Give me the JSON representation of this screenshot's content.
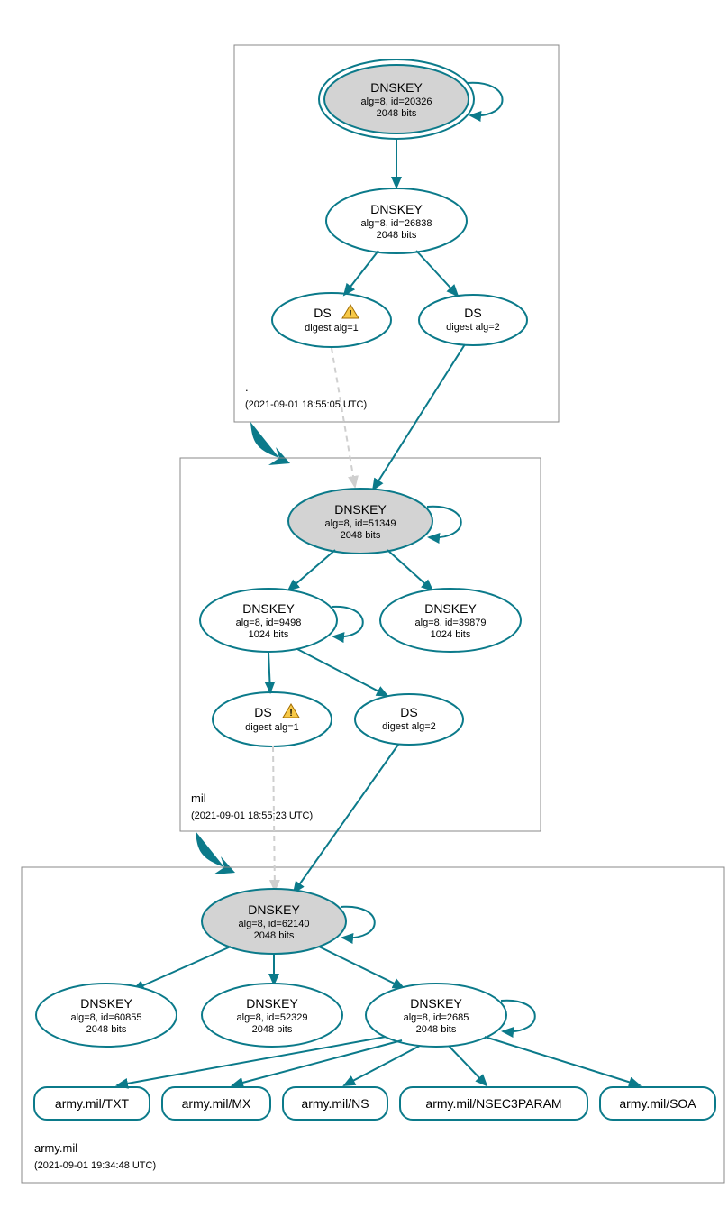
{
  "colors": {
    "stroke": "#0b7a8a",
    "fill_key": "#d3d3d3"
  },
  "zones": {
    "root": {
      "label": ".",
      "timestamp": "(2021-09-01 18:55:05 UTC)"
    },
    "mil": {
      "label": "mil",
      "timestamp": "(2021-09-01 18:55:23 UTC)"
    },
    "army": {
      "label": "army.mil",
      "timestamp": "(2021-09-01 19:34:48 UTC)"
    }
  },
  "nodes": {
    "root_ksk": {
      "title": "DNSKEY",
      "line1": "alg=8, id=20326",
      "line2": "2048 bits"
    },
    "root_zsk": {
      "title": "DNSKEY",
      "line1": "alg=8, id=26838",
      "line2": "2048 bits"
    },
    "root_ds1": {
      "title": "DS",
      "line1": "digest alg=1",
      "warn": true
    },
    "root_ds2": {
      "title": "DS",
      "line1": "digest alg=2"
    },
    "mil_ksk": {
      "title": "DNSKEY",
      "line1": "alg=8, id=51349",
      "line2": "2048 bits"
    },
    "mil_zsk1": {
      "title": "DNSKEY",
      "line1": "alg=8, id=9498",
      "line2": "1024 bits"
    },
    "mil_zsk2": {
      "title": "DNSKEY",
      "line1": "alg=8, id=39879",
      "line2": "1024 bits"
    },
    "mil_ds1": {
      "title": "DS",
      "line1": "digest alg=1",
      "warn": true
    },
    "mil_ds2": {
      "title": "DS",
      "line1": "digest alg=2"
    },
    "army_ksk": {
      "title": "DNSKEY",
      "line1": "alg=8, id=62140",
      "line2": "2048 bits"
    },
    "army_k1": {
      "title": "DNSKEY",
      "line1": "alg=8, id=60855",
      "line2": "2048 bits"
    },
    "army_k2": {
      "title": "DNSKEY",
      "line1": "alg=8, id=52329",
      "line2": "2048 bits"
    },
    "army_k3": {
      "title": "DNSKEY",
      "line1": "alg=8, id=2685",
      "line2": "2048 bits"
    }
  },
  "rr": {
    "txt": "army.mil/TXT",
    "mx": "army.mil/MX",
    "ns": "army.mil/NS",
    "nsec": "army.mil/NSEC3PARAM",
    "soa": "army.mil/SOA"
  }
}
